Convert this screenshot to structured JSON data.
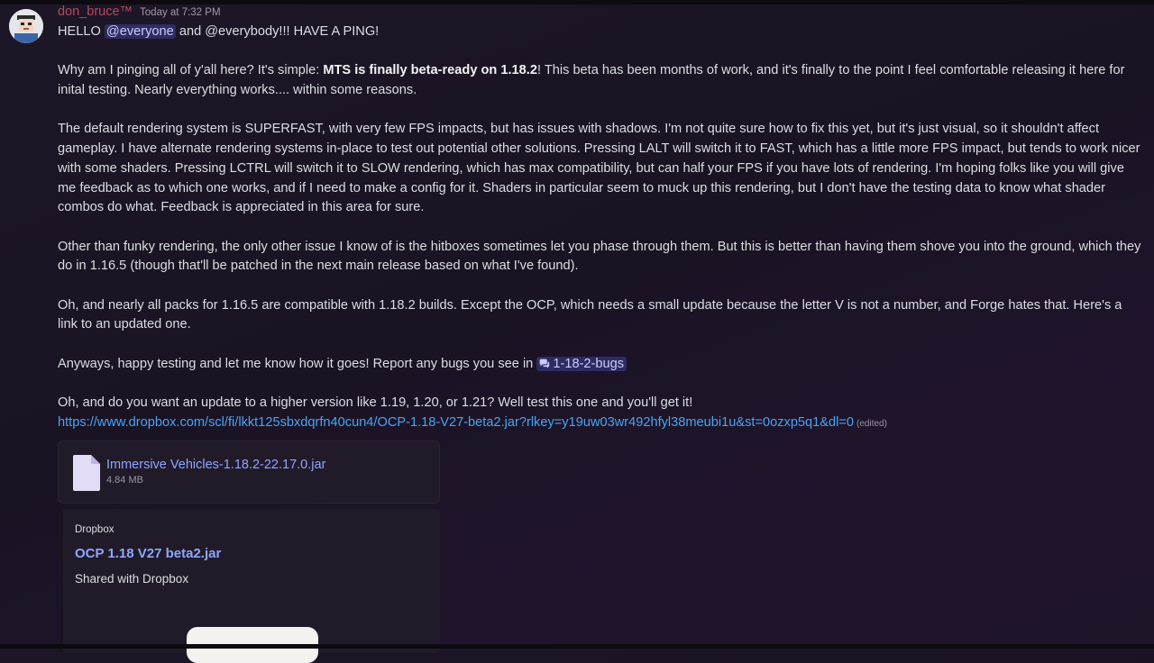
{
  "message": {
    "username": "don_bruce™",
    "timestamp": "Today at 7:32 PM",
    "line1": {
      "greeting": "HELLO ",
      "mention_everyone": "@everyone",
      "mid": " and @everybody!!!  HAVE A PING!"
    },
    "para2": {
      "start": "Why am I pinging all of y'all here?  It's simple: ",
      "bold": "MTS is finally beta-ready on 1.18.2",
      "end": "!  This beta has been months of work, and it's finally to the point I feel comfortable releasing it here for inital testing.  Nearly everything works.... within some reasons."
    },
    "para3": "The default rendering system is SUPERFAST, with very few FPS impacts, but has issues with shadows. I'm not quite sure how to fix this yet, but it's just visual, so it shouldn't affect gameplay.  I have alternate rendering systems in-place to test out potential other solutions.  Pressing LALT will switch it to FAST, which has a little more FPS impact, but tends to work nicer with some shaders.  Pressing LCTRL will switch it to SLOW rendering, which has max compatibility, but can half your FPS if you have lots of rendering.  I'm hoping folks like you will give me feedback as to which one works, and if I need to make a config for it.  Shaders in particular seem to muck up this rendering, but I don't have the testing data to know what shader combos do what.  Feedback is appreciated in this area for sure.",
    "para4": "Other than funky rendering, the only other issue I know of is the hitboxes sometimes let you phase through them.  But this is better than having them shove you into the ground, which they do in 1.16.5 (though that'll be patched in the next main release based on what I've found).",
    "para5": "Oh, and nearly all packs for 1.16.5 are compatible with 1.18.2 builds.  Except the OCP, which needs a small update because the letter V is not a number, and Forge hates that. Here's a link to an updated one.",
    "para6": {
      "text": "Anyways, happy testing and let me know how it goes!  Report any bugs you see in ",
      "channel": "1-18-2-bugs"
    },
    "para7": {
      "text": "Oh, and do you want an update to a higher version like 1.19, 1.20, or 1.21?  Well test this one and you'll get it!",
      "link": "https://www.dropbox.com/scl/fi/lkkt125sbxdqrfn40cun4/OCP-1.18-V27-beta2.jar?rlkey=y19uw03wr492hfyl38meubi1u&st=0ozxp5q1&dl=0",
      "edited": "(edited)"
    }
  },
  "attachment": {
    "file_name": "Immersive Vehicles-1.18.2-22.17.0.jar",
    "file_size": "4.84 MB"
  },
  "embed": {
    "provider": "Dropbox",
    "title": "OCP 1.18 V27 beta2.jar",
    "description": "Shared with Dropbox"
  },
  "colors": {
    "username": "#b8485d",
    "link": "#4ba3f2",
    "mention_bg": "#3b3a7a"
  }
}
